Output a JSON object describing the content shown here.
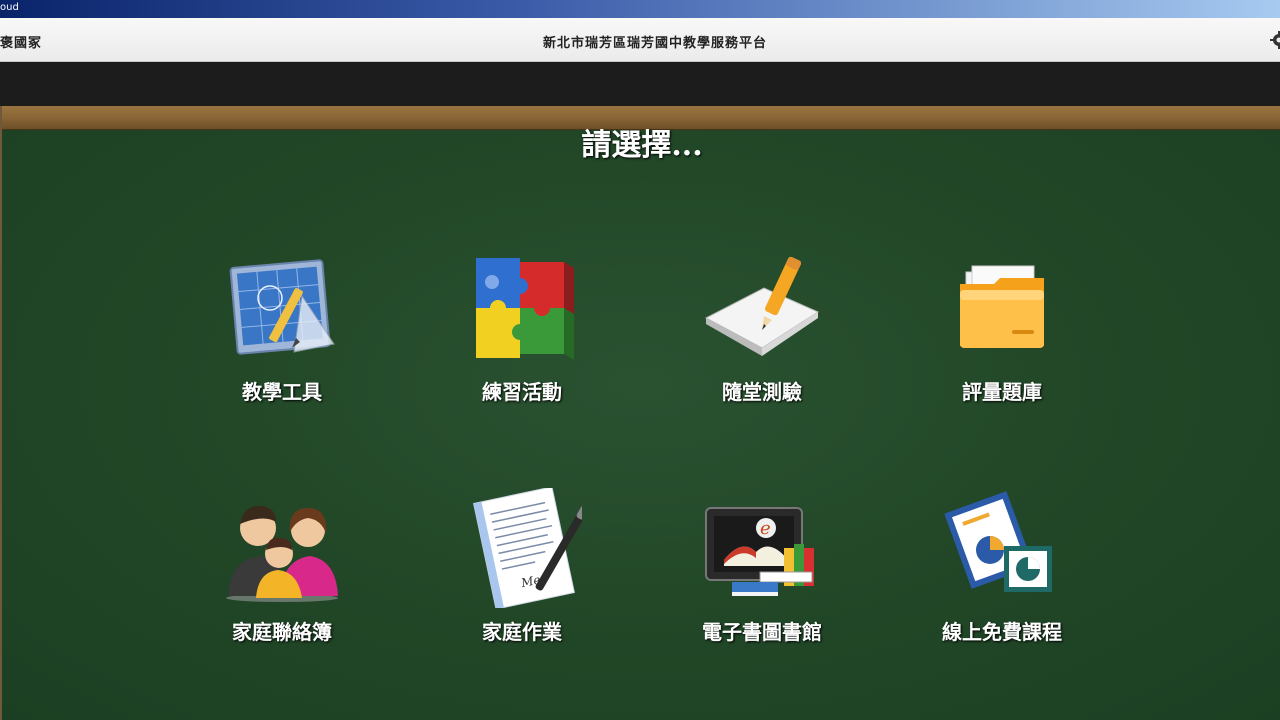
{
  "window": {
    "title_fragment": "oud"
  },
  "navbar": {
    "left_text": "褒國冢",
    "title": "新北市瑞芳區瑞芳國中教學服務平台",
    "settings_icon": "gear-icon"
  },
  "board": {
    "heading": "請選擇...",
    "tiles": [
      {
        "label": "教學工具",
        "icon": "blueprint-pencil-icon"
      },
      {
        "label": "練習活動",
        "icon": "puzzle-cube-icon"
      },
      {
        "label": "隨堂測驗",
        "icon": "pencil-on-paper-icon"
      },
      {
        "label": "評量題庫",
        "icon": "folder-icon"
      },
      {
        "label": "家庭聯絡簿",
        "icon": "family-icon"
      },
      {
        "label": "家庭作業",
        "icon": "handwritten-letter-pen-icon"
      },
      {
        "label": "電子書圖書館",
        "icon": "ebook-library-icon"
      },
      {
        "label": "線上免費課程",
        "icon": "presentation-chart-icon"
      }
    ]
  },
  "colors": {
    "chalkboard": "#224828",
    "frame": "#8a6535",
    "titlebar_start": "#0a246a",
    "titlebar_end": "#a6caf0"
  }
}
